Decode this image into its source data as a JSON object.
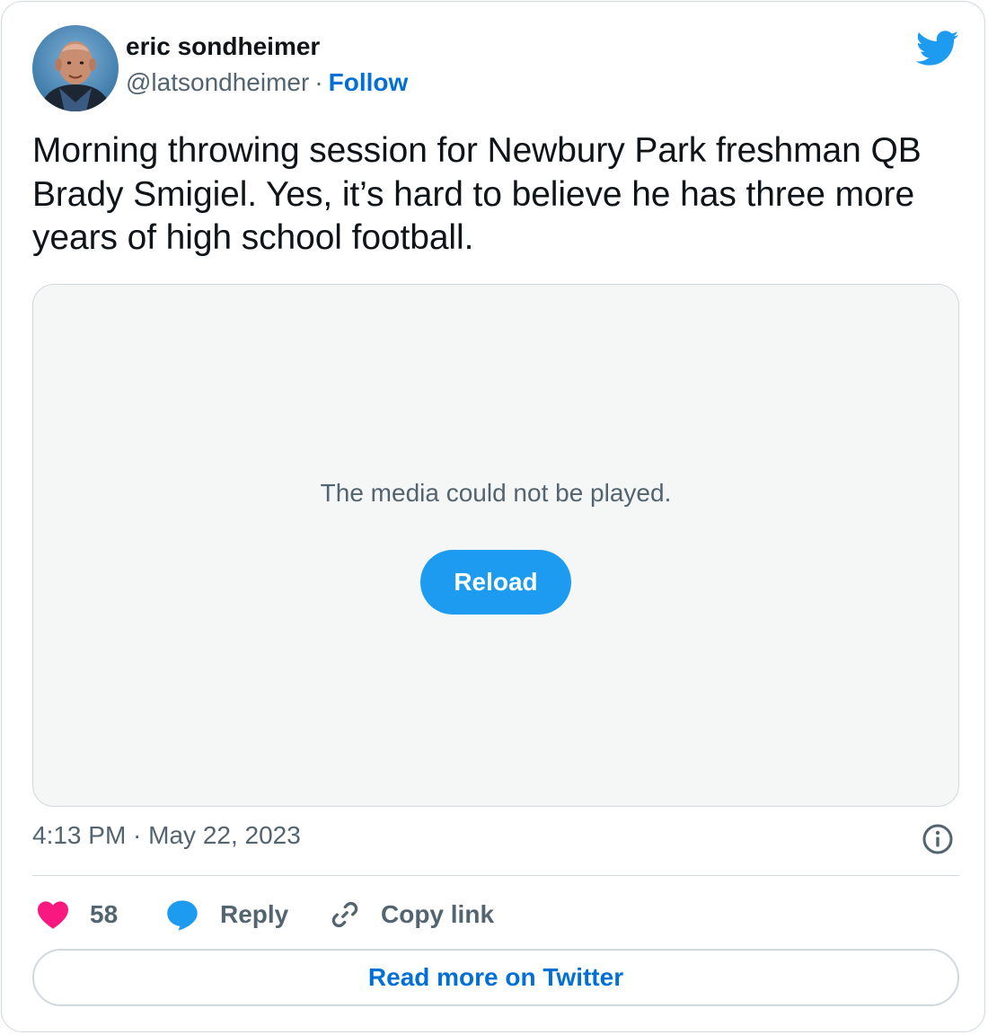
{
  "author": {
    "name": "eric sondheimer",
    "handle": "@latsondheimer",
    "separator": "·",
    "follow_label": "Follow"
  },
  "tweet": {
    "text": "Morning throwing session for Newbury Park freshman QB Brady Smigiel. Yes, it’s hard to believe he has three more years of high school football.",
    "timestamp": "4:13 PM · May 22, 2023"
  },
  "media": {
    "error_message": "The media could not be played.",
    "reload_label": "Reload"
  },
  "actions": {
    "like_count": "58",
    "reply_label": "Reply",
    "copy_link_label": "Copy link"
  },
  "footer": {
    "read_more_label": "Read more on Twitter"
  },
  "icons": {
    "brand": "twitter-bird-icon",
    "like": "heart-icon",
    "reply": "speech-bubble-icon",
    "copy": "link-icon",
    "info": "info-icon"
  },
  "colors": {
    "brand_blue": "#1d9bf0",
    "link_blue": "#006fd6",
    "heart_pink": "#f91880",
    "text_primary": "#0f1419",
    "text_secondary": "#536471",
    "border": "#cfd9de",
    "media_bg": "#f5f7f7"
  }
}
